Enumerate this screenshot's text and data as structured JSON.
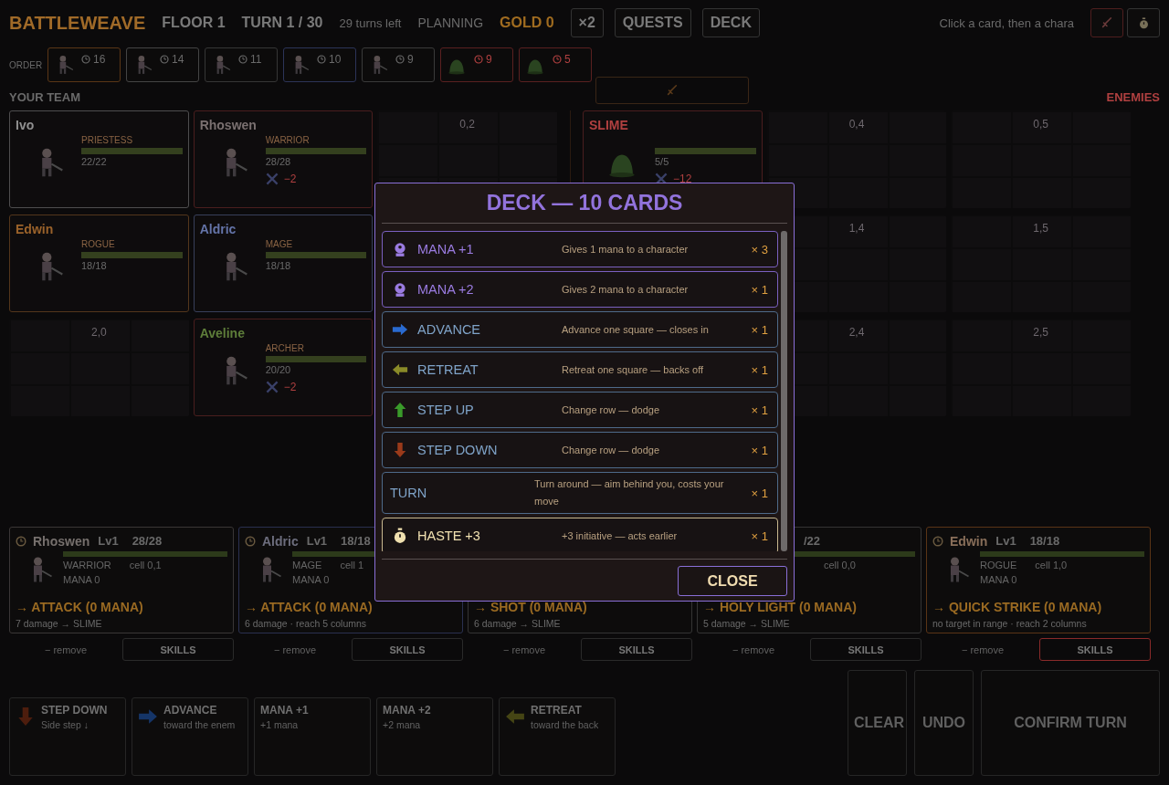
{
  "topbar": {
    "title": "BATTLEWEAVE",
    "floor": "FLOOR 1",
    "turn": "TURN 1 / 30",
    "turns_left": "29 turns left",
    "phase": "PLANNING",
    "gold": "GOLD 0",
    "buttons": [
      "×2",
      "QUESTS",
      "DECK"
    ],
    "hint": "Click a card, then a chara"
  },
  "order": {
    "label": "ORDER",
    "chips": [
      {
        "kind": "hero",
        "initiative": "16",
        "color": "#5a3616"
      },
      {
        "kind": "hero",
        "initiative": "14",
        "color": "#444444"
      },
      {
        "kind": "hero",
        "initiative": "11",
        "color": "#363636"
      },
      {
        "kind": "hero",
        "initiative": "10",
        "color": "#2c3458"
      },
      {
        "kind": "hero",
        "initiative": "9",
        "color": "#3a3a3a"
      },
      {
        "kind": "enemy",
        "initiative": "9",
        "color": "#5a2020"
      },
      {
        "kind": "enemy",
        "initiative": "5",
        "color": "#5a2020"
      }
    ]
  },
  "team": {
    "heading": "YOUR TEAM",
    "cells": [
      {
        "kind": "hero",
        "name": "Ivo",
        "role": "PRIESTESS",
        "hp": "22/22",
        "level": 1,
        "color": "#909090"
      },
      {
        "kind": "hero",
        "name": "Rhoswen",
        "role": "WARRIOR",
        "hp": "28/28",
        "level": 1,
        "color": "#7a7070",
        "threat": "−2"
      },
      {
        "kind": "empty",
        "label": "0,2"
      },
      {
        "kind": "hero",
        "name": "Edwin",
        "role": "ROGUE",
        "hp": "18/18",
        "level": 1,
        "color": "#9a622a"
      },
      {
        "kind": "hero",
        "name": "Aldric",
        "role": "MAGE",
        "hp": "18/18",
        "level": 1,
        "color": "#6474a8"
      },
      {
        "kind": "empty"
      },
      {
        "kind": "empty",
        "label": "2,0"
      },
      {
        "kind": "hero",
        "name": "Aveline",
        "role": "ARCHER",
        "hp": "20/20",
        "level": 1,
        "color": "#5e7e3a",
        "threat": "−2"
      },
      {
        "kind": "empty"
      }
    ]
  },
  "enemies": {
    "heading": "ENEMIES",
    "cells": [
      {
        "kind": "enemy",
        "name": "SLIME",
        "hp": "5/5",
        "level": 1,
        "color": "#b04040",
        "threat": "−12"
      },
      {
        "kind": "empty",
        "label": "0,4"
      },
      {
        "kind": "empty",
        "label": "0,5"
      },
      {
        "kind": "empty"
      },
      {
        "kind": "empty",
        "label": "1,4"
      },
      {
        "kind": "empty",
        "label": "1,5"
      },
      {
        "kind": "empty"
      },
      {
        "kind": "empty",
        "label": "2,4"
      },
      {
        "kind": "empty",
        "label": "2,5"
      }
    ]
  },
  "party": [
    {
      "name": "Rhoswen",
      "lv": "Lv1",
      "hp": "28/28",
      "level": 1,
      "role": "WARRIOR",
      "cell": "cell 0,1",
      "mana": "MANA 0",
      "action": "→ ATTACK (0 MANA)",
      "detail": "7 damage → SLIME",
      "color": "#3a3636",
      "remove": "− remove",
      "skills": "SKILLS",
      "alert": false
    },
    {
      "name": "Aldric",
      "lv": "Lv1",
      "hp": "18/18",
      "level": 1,
      "role": "MAGE",
      "cell": "cell 1",
      "mana": "MANA 0",
      "action": "→ ATTACK (0 MANA)",
      "detail": "6 damage · reach 5 columns",
      "color": "#2a3050",
      "remove": "− remove",
      "skills": "SKILLS",
      "alert": false
    },
    {
      "action": "→ SHOT (0 MANA)",
      "detail": "6 damage → SLIME",
      "color": "#343434",
      "remove": "− remove",
      "skills": "SKILLS",
      "alert": false
    },
    {
      "hp": "/22",
      "level": 1,
      "cell": "cell 0,0",
      "action": "→ HOLY LIGHT (0 MANA)",
      "detail": "5 damage → SLIME",
      "color": "#343434",
      "remove": "− remove",
      "skills": "SKILLS",
      "alert": false
    },
    {
      "name": "Edwin",
      "lv": "Lv1",
      "hp": "18/18",
      "level": 1,
      "role": "ROGUE",
      "cell": "cell 1,0",
      "mana": "MANA 0",
      "action": "→ QUICK STRIKE (0 MANA)",
      "detail": "no target in range · reach 2 columns",
      "color": "#5a3416",
      "remove": "− remove",
      "skills": "SKILLS",
      "alert": true
    }
  ],
  "hand": [
    {
      "kind": "step_down",
      "title": "STEP DOWN",
      "subtitle": "Side step ↓"
    },
    {
      "kind": "advance",
      "title": "ADVANCE",
      "subtitle": "toward the enem"
    },
    {
      "kind": "mana",
      "title": "MANA +1",
      "subtitle": "+1 mana"
    },
    {
      "kind": "mana",
      "title": "MANA +2",
      "subtitle": "+2 mana"
    },
    {
      "kind": "retreat",
      "title": "RETREAT",
      "subtitle": "toward the back"
    }
  ],
  "actions": [
    {
      "kind": "small",
      "label": "CLEAR",
      "disabled": true
    },
    {
      "kind": "small",
      "label": "UNDO",
      "disabled": true
    },
    {
      "kind": "wide",
      "label": "CONFIRM TURN",
      "disabled": true
    }
  ],
  "deck_modal": {
    "title": "DECK — 10 CARDS",
    "cards": [
      {
        "kind": "mana",
        "name": "MANA +1",
        "description": "Gives 1 mana to a character",
        "count": "× 3"
      },
      {
        "kind": "mana",
        "name": "MANA +2",
        "description": "Gives 2 mana to a character",
        "count": "× 1"
      },
      {
        "kind": "advance",
        "name": "ADVANCE",
        "description": "Advance one square — closes in",
        "count": "× 1"
      },
      {
        "kind": "retreat",
        "name": "RETREAT",
        "description": "Retreat one square — backs off",
        "count": "× 1"
      },
      {
        "kind": "step_up",
        "name": "STEP UP",
        "description": "Change row — dodge",
        "count": "× 1"
      },
      {
        "kind": "step_down",
        "name": "STEP DOWN",
        "description": "Change row — dodge",
        "count": "× 1"
      },
      {
        "kind": "turn",
        "name": "TURN",
        "description": "Turn around — aim behind you, costs your move",
        "count": "× 1"
      },
      {
        "kind": "haste",
        "name": "HASTE +3",
        "description": "+3 initiative — acts earlier",
        "count": "× 1"
      }
    ],
    "close": "CLOSE"
  }
}
